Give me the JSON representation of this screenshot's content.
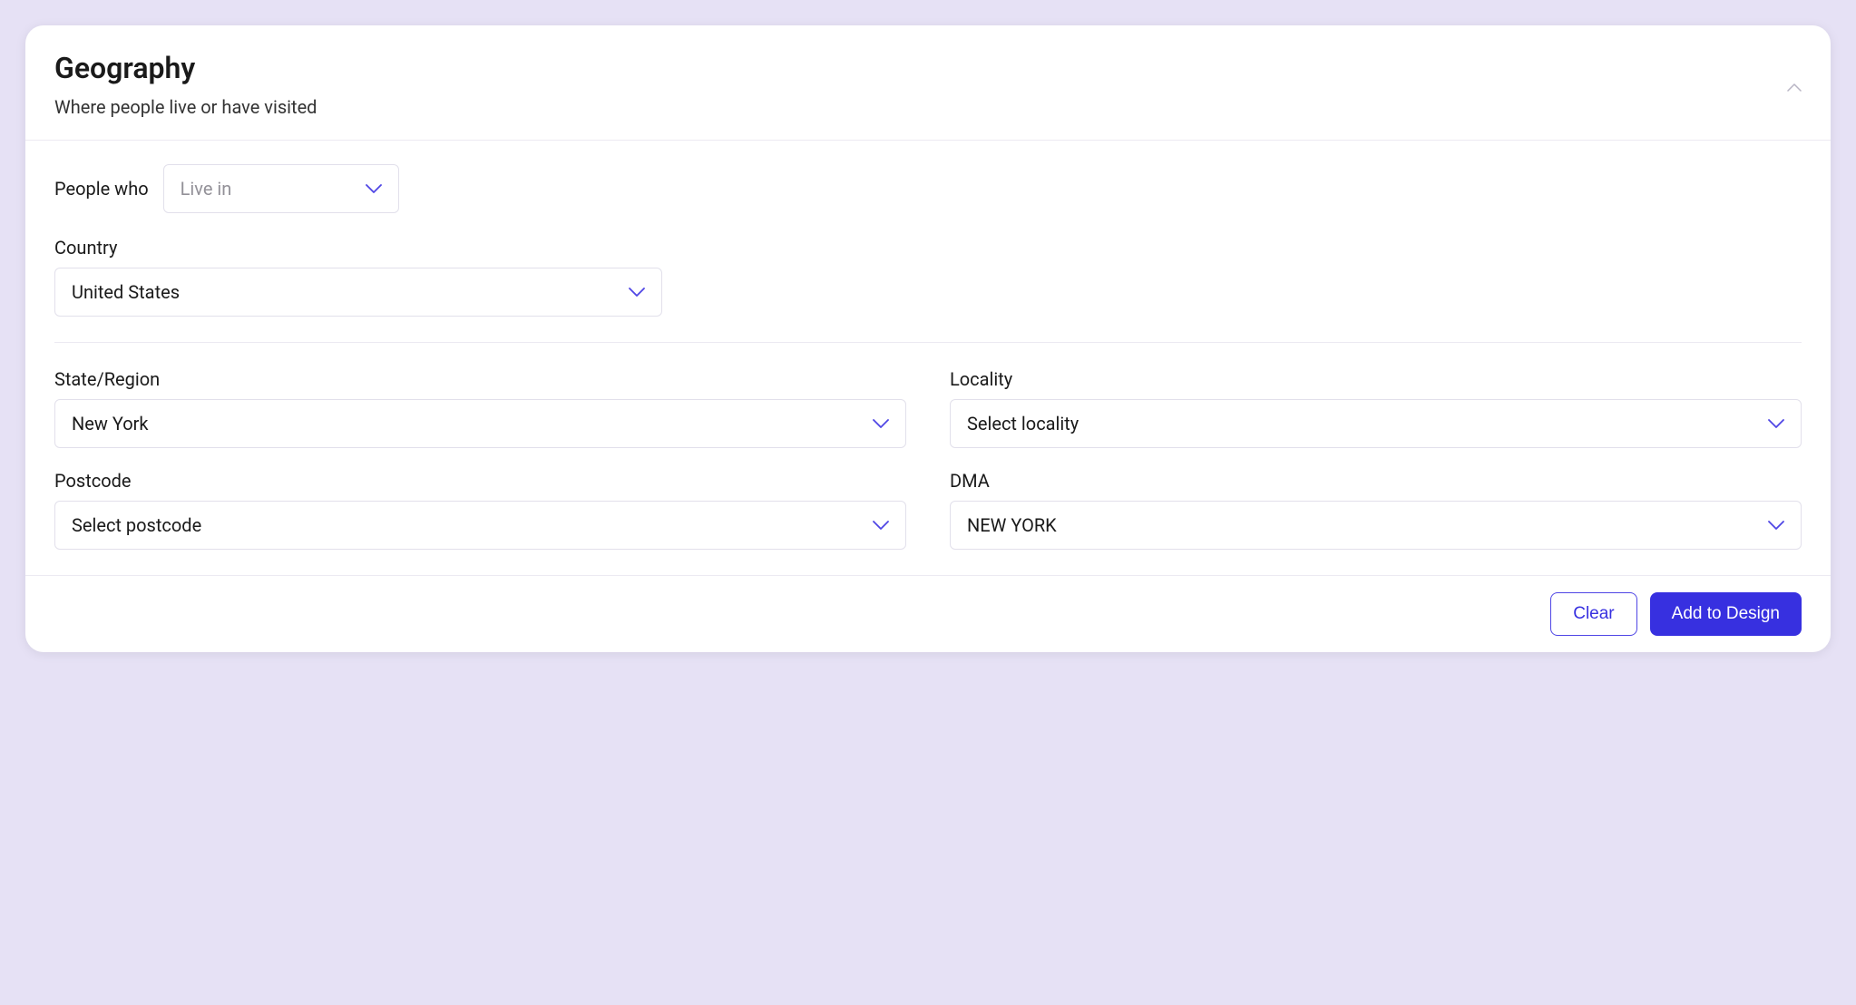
{
  "header": {
    "title": "Geography",
    "subtitle": "Where people live or have visited"
  },
  "people_who": {
    "label": "People who",
    "selected": "Live in"
  },
  "country": {
    "label": "Country",
    "selected": "United States"
  },
  "fields": {
    "state_region": {
      "label": "State/Region",
      "selected": "New York",
      "is_placeholder": false
    },
    "locality": {
      "label": "Locality",
      "selected": "Select locality",
      "is_placeholder": true
    },
    "postcode": {
      "label": "Postcode",
      "selected": "Select postcode",
      "is_placeholder": true
    },
    "dma": {
      "label": "DMA",
      "selected": "NEW YORK",
      "is_placeholder": false
    }
  },
  "footer": {
    "clear": "Clear",
    "add": "Add to Design"
  }
}
